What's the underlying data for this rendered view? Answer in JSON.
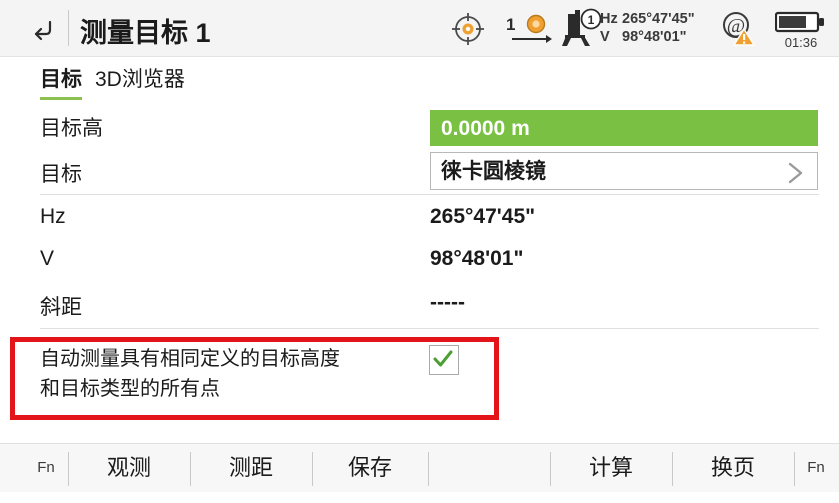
{
  "header": {
    "back_icon": "back-arrow-icon",
    "title": "测量目标 1",
    "status": {
      "reticle_icon": "crosshair-target-icon",
      "prism_count": "1",
      "prism_icon": "prism-icon",
      "instrument_icon": "total-station-icon",
      "instrument_badge": "1",
      "hz_label": "Hz",
      "hz_value": "265°47'45\"",
      "v_label": "V",
      "v_value": "98°48'01\"",
      "atr_icon": "atr-warning-icon",
      "battery_icon": "battery-icon",
      "battery_time": "01:36"
    }
  },
  "tabs": [
    {
      "label": "目标",
      "active": true
    },
    {
      "label": "3D浏览器",
      "active": false
    }
  ],
  "form": {
    "rows": [
      {
        "label": "目标高",
        "value": "0.0000 m",
        "kind": "field-green"
      },
      {
        "label": "目标",
        "value": "徕卡圆棱镜",
        "kind": "field-white",
        "chevron": "chevron-right-icon"
      },
      {
        "label": "Hz",
        "value": "265°47'45\"",
        "kind": "readonly"
      },
      {
        "label": "V",
        "value": "98°48'01\"",
        "kind": "readonly"
      },
      {
        "label": "斜距",
        "value": "-----",
        "kind": "readonly"
      }
    ]
  },
  "auto_measure": {
    "text_line1": "自动测量具有相同定义的目标高度",
    "text_line2": "和目标类型的所有点",
    "checked": true,
    "check_icon": "checkmark-icon"
  },
  "toolbar": {
    "buttons": [
      {
        "label": "Fn"
      },
      {
        "label": "观测"
      },
      {
        "label": "测距"
      },
      {
        "label": "保存"
      },
      {
        "label": ""
      },
      {
        "label": "计算"
      },
      {
        "label": "换页"
      },
      {
        "label": "Fn"
      }
    ]
  },
  "colors": {
    "accent_green": "#79c043",
    "highlight_red": "#e3151a",
    "header_bg": "#f4f4f4",
    "toolbar_bg": "#f7f7f7",
    "warning_orange": "#f0a030"
  }
}
